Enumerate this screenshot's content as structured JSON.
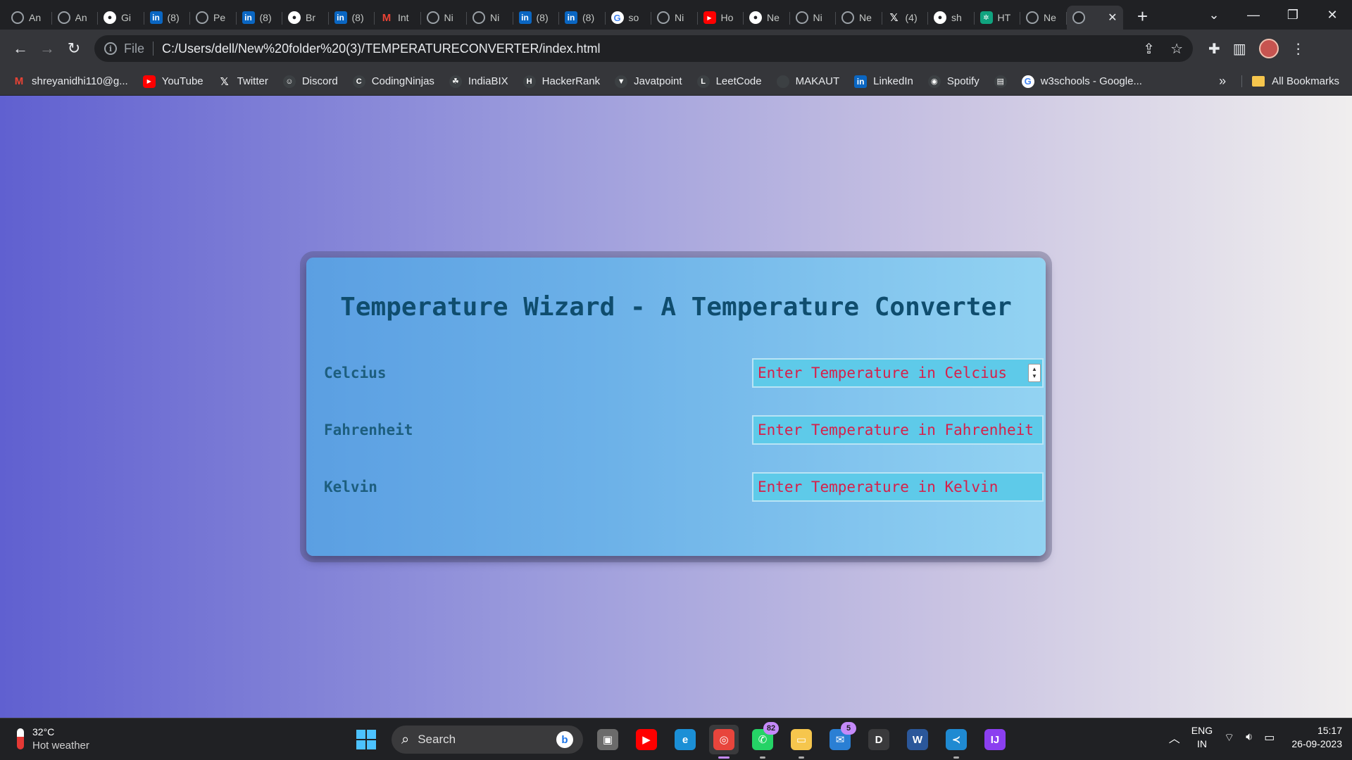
{
  "browser": {
    "tabs": [
      {
        "icon": "globe-icon",
        "title": "An"
      },
      {
        "icon": "globe-icon",
        "title": "An"
      },
      {
        "icon": "github-icon",
        "title": "Gi"
      },
      {
        "icon": "linkedin-icon",
        "title": "(8)"
      },
      {
        "icon": "globe-icon",
        "title": "Pe"
      },
      {
        "icon": "linkedin-icon",
        "title": "(8)"
      },
      {
        "icon": "github-icon",
        "title": "Br"
      },
      {
        "icon": "linkedin-icon",
        "title": "(8)"
      },
      {
        "icon": "gmail-icon",
        "title": "Int"
      },
      {
        "icon": "globe-icon",
        "title": "Ni"
      },
      {
        "icon": "globe-icon",
        "title": "Ni"
      },
      {
        "icon": "linkedin-icon",
        "title": "(8)"
      },
      {
        "icon": "linkedin-icon",
        "title": "(8)"
      },
      {
        "icon": "google-icon",
        "title": "so"
      },
      {
        "icon": "globe-icon",
        "title": "Ni"
      },
      {
        "icon": "youtube-icon",
        "title": "Ho"
      },
      {
        "icon": "github-icon",
        "title": "Ne"
      },
      {
        "icon": "globe-icon",
        "title": "Ni"
      },
      {
        "icon": "globe-icon",
        "title": "Ne"
      },
      {
        "icon": "x-icon",
        "title": "(4)"
      },
      {
        "icon": "github-icon",
        "title": "sh"
      },
      {
        "icon": "chatgpt-icon",
        "title": "HT"
      },
      {
        "icon": "globe-icon",
        "title": "Ne"
      }
    ],
    "new_tab_label": "+",
    "address": {
      "scheme_label": "File",
      "url": "C:/Users/dell/New%20folder%20(3)/TEMPERATURECONVERTER/index.html"
    },
    "bookmarks": [
      {
        "icon": "gmail-icon",
        "label": "shreyanidhi110@g..."
      },
      {
        "icon": "youtube-icon",
        "label": "YouTube"
      },
      {
        "icon": "x-icon",
        "label": "Twitter"
      },
      {
        "icon": "discord-icon",
        "label": "Discord"
      },
      {
        "icon": "codingninjas-icon",
        "label": "CodingNinjas"
      },
      {
        "icon": "indiabix-icon",
        "label": "IndiaBIX"
      },
      {
        "icon": "hackerrank-icon",
        "label": "HackerRank"
      },
      {
        "icon": "javatpoint-icon",
        "label": "Javatpoint"
      },
      {
        "icon": "leetcode-icon",
        "label": "LeetCode"
      },
      {
        "icon": "makaut-icon",
        "label": "MAKAUT"
      },
      {
        "icon": "linkedin-icon",
        "label": "LinkedIn"
      },
      {
        "icon": "spotify-icon",
        "label": "Spotify"
      },
      {
        "icon": "bookmark-icon",
        "label": ""
      },
      {
        "icon": "google-icon",
        "label": "w3schools - Google..."
      }
    ],
    "bookmarks_more": "»",
    "all_bookmarks_label": "All Bookmarks"
  },
  "page": {
    "title": "Temperature Wizard - A Temperature Converter",
    "fields": [
      {
        "label": "Celcius",
        "placeholder": "Enter Temperature in Celcius",
        "value": ""
      },
      {
        "label": "Fahrenheit",
        "placeholder": "Enter Temperature in Fahrenheit",
        "value": ""
      },
      {
        "label": "Kelvin",
        "placeholder": "Enter Temperature in Kelvin",
        "value": ""
      }
    ],
    "colors": {
      "title": "#0f4d6e",
      "label": "#1d5e7e",
      "input_text": "#d6204a",
      "input_bg": "#5ecae9"
    }
  },
  "taskbar": {
    "weather": {
      "temp": "32°C",
      "desc": "Hot weather"
    },
    "search_placeholder": "Search",
    "apps": [
      {
        "name": "task-view-icon",
        "badge": ""
      },
      {
        "name": "youtube-app-icon",
        "badge": ""
      },
      {
        "name": "edge-icon",
        "badge": ""
      },
      {
        "name": "chrome-icon",
        "badge": ""
      },
      {
        "name": "whatsapp-icon",
        "badge": "82"
      },
      {
        "name": "file-explorer-icon",
        "badge": ""
      },
      {
        "name": "mail-icon",
        "badge": "5"
      },
      {
        "name": "dell-icon",
        "badge": ""
      },
      {
        "name": "word-icon",
        "badge": ""
      },
      {
        "name": "vscode-icon",
        "badge": ""
      },
      {
        "name": "intellij-icon",
        "badge": ""
      }
    ],
    "lang": {
      "line1": "ENG",
      "line2": "IN"
    },
    "clock": {
      "time": "15:17",
      "date": "26-09-2023"
    }
  }
}
